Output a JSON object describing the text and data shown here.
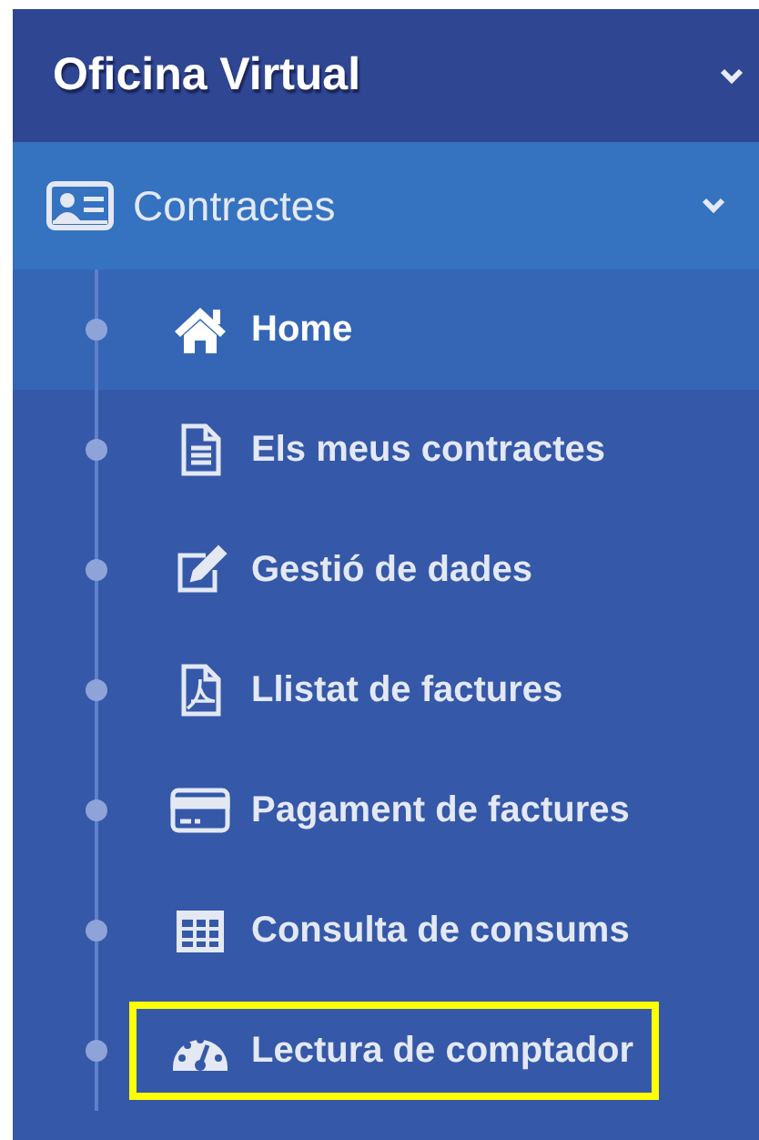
{
  "header": {
    "title": "Oficina Virtual",
    "expanded": true
  },
  "section": {
    "label": "Contractes",
    "expanded": true
  },
  "items": [
    {
      "label": "Home",
      "kind": "home",
      "selected": true,
      "highlighted": false
    },
    {
      "label": "Els meus contractes",
      "kind": "document",
      "selected": false,
      "highlighted": false
    },
    {
      "label": "Gestió de dades",
      "kind": "edit",
      "selected": false,
      "highlighted": false
    },
    {
      "label": "Llistat de factures",
      "kind": "pdf",
      "selected": false,
      "highlighted": false
    },
    {
      "label": "Pagament de factures",
      "kind": "card",
      "selected": false,
      "highlighted": false
    },
    {
      "label": "Consulta de consums",
      "kind": "table",
      "selected": false,
      "highlighted": false
    },
    {
      "label": "Lectura de comptador",
      "kind": "gauge",
      "selected": false,
      "highlighted": true
    }
  ]
}
